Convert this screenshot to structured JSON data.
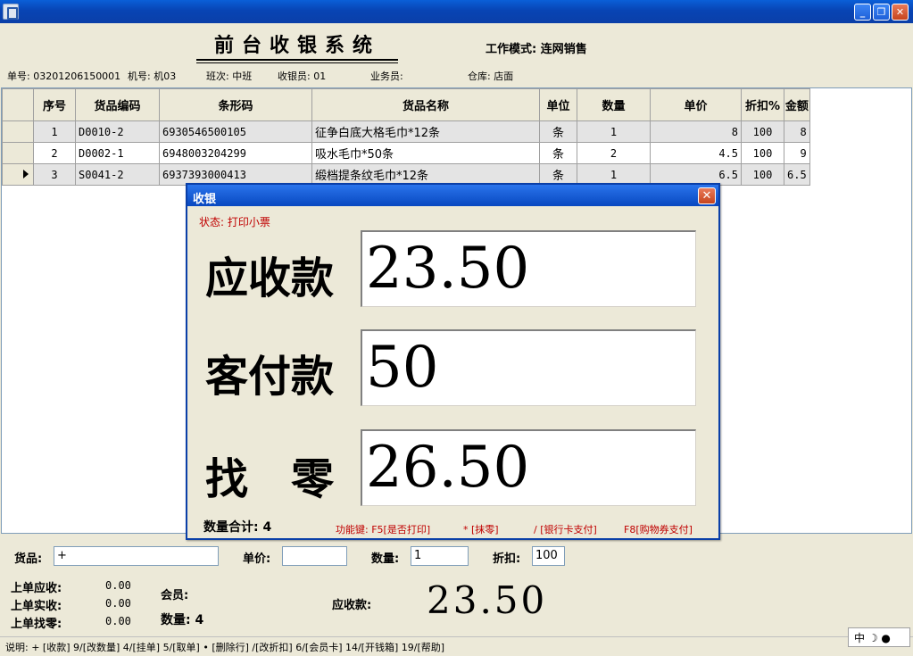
{
  "window": {
    "minimize": "_",
    "restore": "❐",
    "close": "✕"
  },
  "header": {
    "title": "前台收银系统",
    "work_mode": "工作模式: 连网销售",
    "order_no": "单号: 03201206150001",
    "machine": "机号: 机03",
    "shift": "班次: 中班",
    "cashier": "收银员: 01",
    "salesman": "业务员:",
    "warehouse": "仓库: 店面"
  },
  "table": {
    "columns": [
      "序号",
      "货品编码",
      "条形码",
      "货品名称",
      "单位",
      "数量",
      "单价",
      "折扣%",
      "金额"
    ],
    "rows": [
      {
        "seq": "1",
        "code": "D0010-2",
        "barcode": "6930546500105",
        "name": "征争白底大格毛巾*12条",
        "unit": "条",
        "qty": "1",
        "price": "8",
        "discount": "100",
        "amount": "8"
      },
      {
        "seq": "2",
        "code": "D0002-1",
        "barcode": "6948003204299",
        "name": "吸水毛巾*50条",
        "unit": "条",
        "qty": "2",
        "price": "4.5",
        "discount": "100",
        "amount": "9"
      },
      {
        "seq": "3",
        "code": "S0041-2",
        "barcode": "6937393000413",
        "name": "缎档提条纹毛巾*12条",
        "unit": "条",
        "qty": "1",
        "price": "6.5",
        "discount": "100",
        "amount": "6.5"
      }
    ]
  },
  "dialog": {
    "title": "收银",
    "close": "✕",
    "status": "状态: 打印小票",
    "receivable_label": "应收款",
    "receivable_value": "23.50",
    "paid_label": "客付款",
    "paid_value": "50",
    "change_label": "找　零",
    "change_value": "26.50",
    "count": "数量合计: 4",
    "keys": {
      "k1": "功能键: F5[是否打印]",
      "k2": "* [抹零]",
      "k3": "/ [银行卡支付]",
      "k4": "F8[购物券支付]"
    }
  },
  "bottom": {
    "goods_label": "货品:",
    "goods_value": "+",
    "price_label": "单价:",
    "price_value": "",
    "qty_label": "数量:",
    "qty_value": "1",
    "discount_label": "折扣:",
    "discount_value": "100",
    "last_receivable_label": "上单应收:",
    "last_receivable_value": "0.00",
    "last_paid_label": "上单实收:",
    "last_paid_value": "0.00",
    "last_change_label": "上单找零:",
    "last_change_value": "0.00",
    "member_label": "会员:",
    "qty_total": "数量: 4",
    "receivable_label": "应收款:",
    "receivable_value": "23.50"
  },
  "statusbar": {
    "text": "说明: + [收款]  9/[改数量]  4/[挂单]  5/[取单]  • [删除行]  /[改折扣]  6/[会员卡]  14/[开钱箱]  19/[帮助]"
  },
  "ime": {
    "text": "中 ☽ ●"
  }
}
